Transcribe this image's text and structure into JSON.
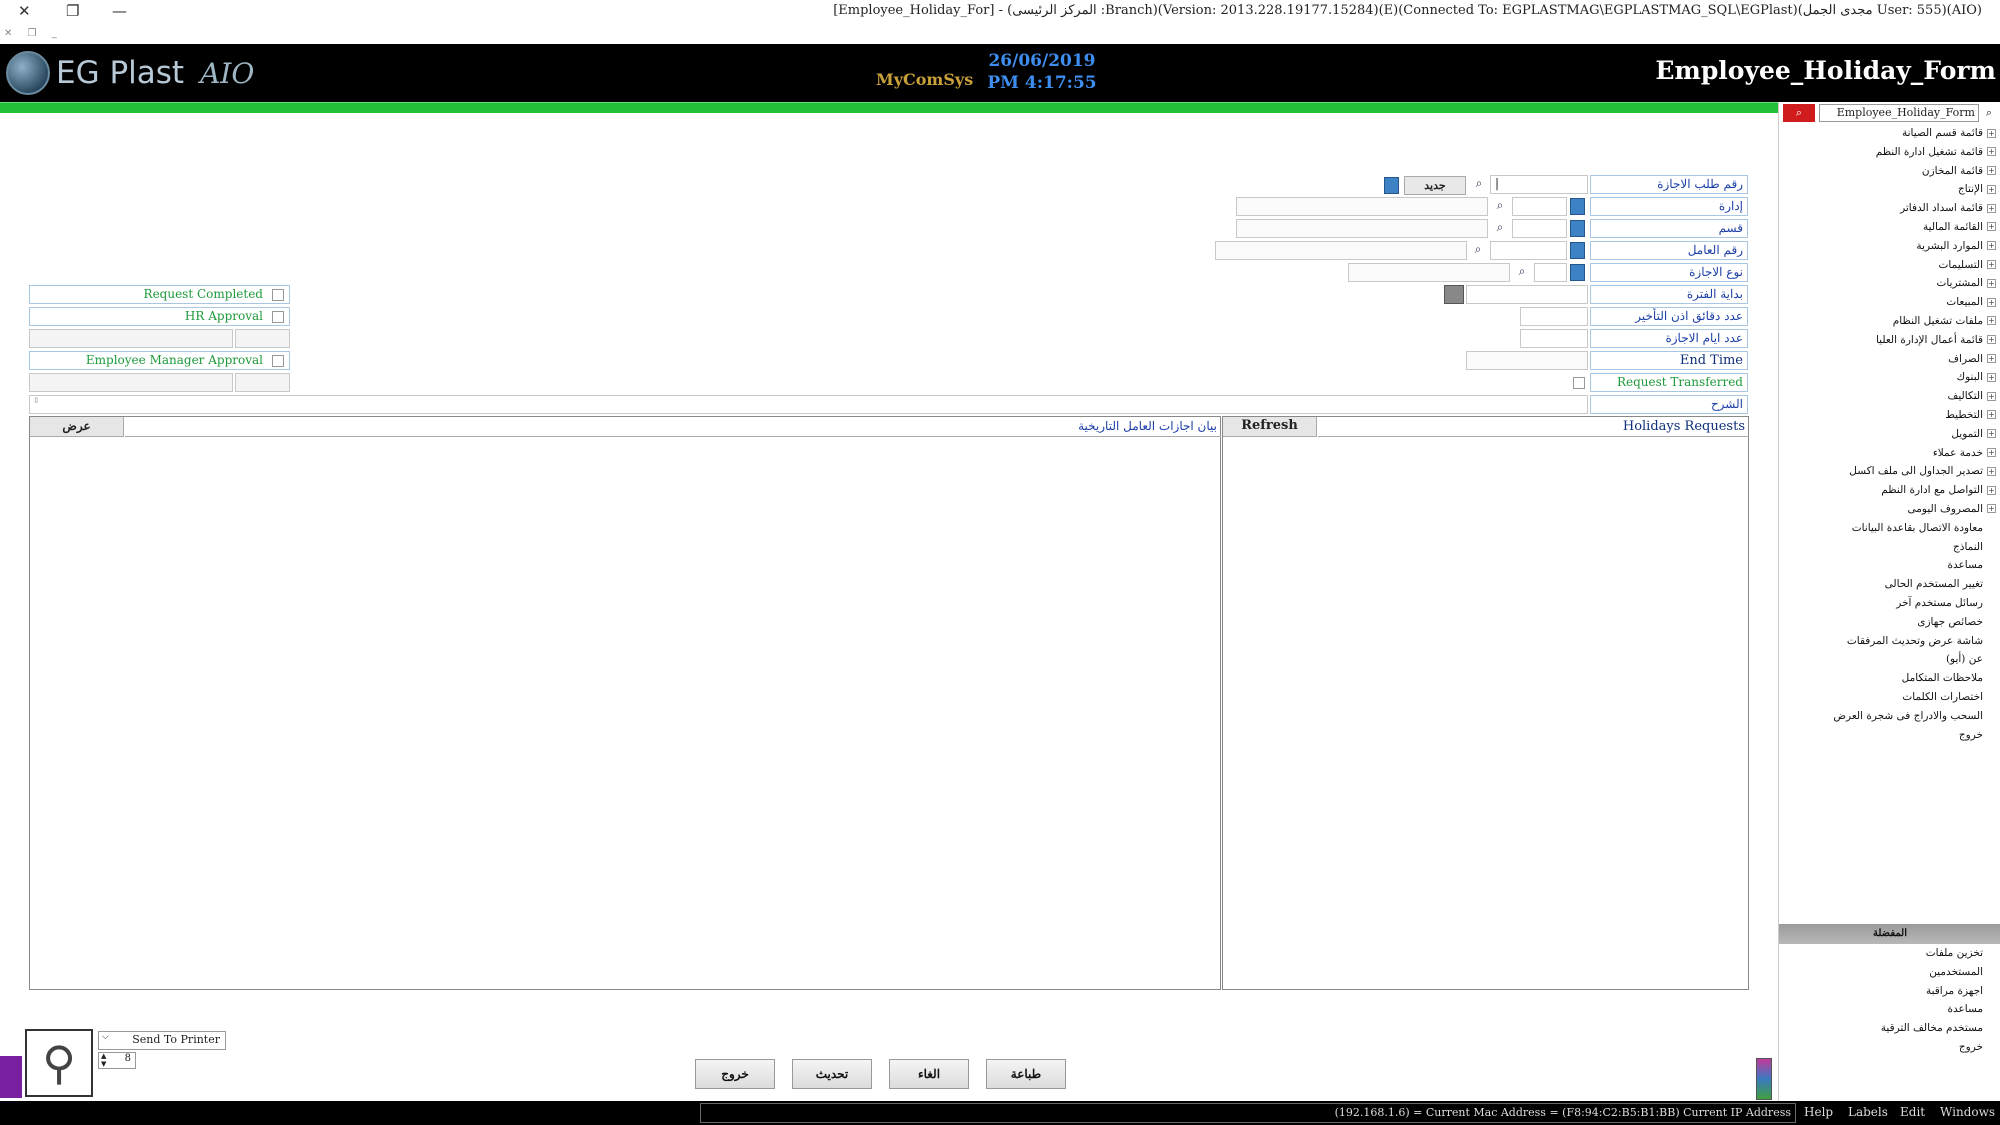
{
  "window": {
    "title": "[Employee_Holiday_For] - (المركز الرئيسى :Branch)(Version: 2013.228.19177.15284)(E)(Connected To: EGPLASTMAG\\EGPLASTMAG_SQL\\EGPlast)(مجدى الجمل User: 555)(AIO)",
    "close_icon": "✕",
    "restore_icon": "❐",
    "minimize_icon": "—",
    "sub_controls": "✕ ❐ _"
  },
  "header": {
    "logo_text": "EG Plast",
    "logo_script": "AIO",
    "company": "MyComSys",
    "date": "26/06/2019",
    "time": "PM 4:17:55",
    "form_title": "Employee_Holiday_Form"
  },
  "form": {
    "request_no_label": "رقم طلب الاجازة",
    "request_no_value": "|",
    "new_button": "جديد",
    "department_label": "إدارة",
    "section_label": "قسم",
    "employee_no_label": "رقم العامل",
    "leave_type_label": "نوع الاجازة",
    "period_start_label": "بداية الفترة",
    "delay_minutes_label": "عدد دقائق اذن التأخير",
    "leave_days_label": "عدد ايام الاجازة",
    "end_time_label": "End Time",
    "request_transferred_label": "Request Transferred",
    "explanation_label": "الشرح",
    "request_completed_label": "Request Completed",
    "hr_approval_label": "HR Approval",
    "employee_manager_approval_label": "Employee Manager Approval"
  },
  "history_panel": {
    "view_button": "عرض",
    "title": "بيان اجازات العامل التاريخية"
  },
  "requests_panel": {
    "refresh_button": "Refresh",
    "title": "Holidays Requests"
  },
  "bottom": {
    "send_to_printer": "Send To Printer",
    "copies": "8",
    "print_button": "طباعة",
    "cancel_button": "الغاء",
    "update_button": "تحديث",
    "exit_button": "خروج"
  },
  "sidebar": {
    "search_value": "Employee_Holiday_Form",
    "tree_items": [
      "قائمة قسم الصيانة",
      "قائمة تشغيل ادارة النظم",
      "قائمة المخازن",
      "الإنتاج",
      "قائمة اسداد الدفاتر",
      "القائمة المالية",
      "الموارد البشرية",
      "التسليمات",
      "المشتريات",
      "المبيعات",
      "ملفات تشغيل النظام",
      "قائمة أعمال الإدارة العليا",
      "الصراف",
      "البنوك",
      "التكاليف",
      "التخطيط",
      "التمويل",
      "خدمة عملاء",
      "تصدير الجداول الى ملف اكسل",
      "التواصل مع ادارة النظم",
      "المصروف اليومى",
      "معاودة الاتصال بقاعدة البيانات",
      "النماذج",
      "مساعدة",
      "تغيير المستخدم الحالى",
      "رسائل مستخدم آخر",
      "خصائص جهازى",
      "شاشة عرض وتحديث المرفقات",
      "عن (أيو)",
      "ملاحظات المتكامل",
      "اختصارات الكلمات",
      "السحب والادراج فى شجرة العرض",
      "خروج"
    ],
    "favorites_title": "المفضلة",
    "favorites": [
      "تخزين ملفات",
      "المستخدمين",
      "اجهزة مراقبة",
      "مساعدة",
      "مستخدم مخالف الترقية",
      "خروج"
    ]
  },
  "statusbar": {
    "ip_text": "(192.168.1.6) = Current Mac Address = (F8:94:C2:B5:B1:BB) Current IP Address",
    "menus": [
      "Help",
      "Labels",
      "Edit",
      "Windows"
    ]
  },
  "colors": {
    "accent_green": "#22c038",
    "label_blue": "#1c3fa8",
    "header_bg": "#000000"
  }
}
